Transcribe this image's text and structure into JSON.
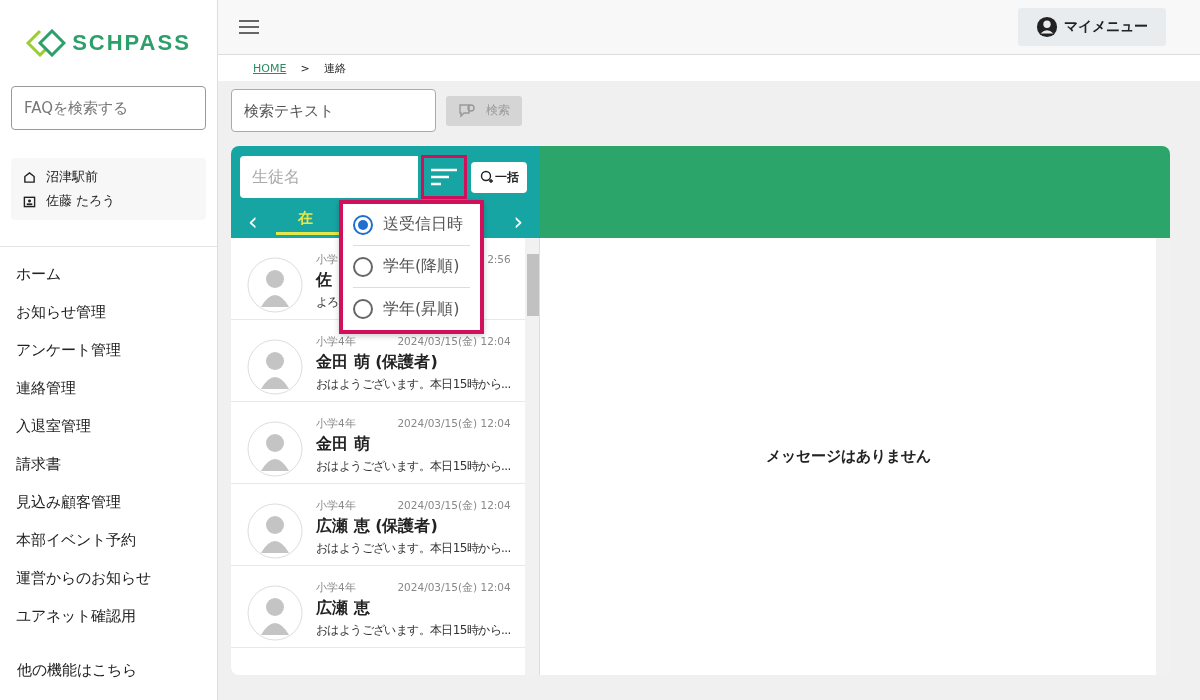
{
  "logo": {
    "text": "SCHPASS"
  },
  "faq_search": {
    "placeholder": "FAQを検索する"
  },
  "account": {
    "school": "沼津駅前",
    "user": "佐藤 たろう"
  },
  "nav": [
    {
      "label": "ホーム"
    },
    {
      "label": "お知らせ管理"
    },
    {
      "label": "アンケート管理"
    },
    {
      "label": "連絡管理"
    },
    {
      "label": "入退室管理"
    },
    {
      "label": "請求書"
    },
    {
      "label": "見込み顧客管理"
    },
    {
      "label": "本部イベント予約"
    },
    {
      "label": "運営からのお知らせ"
    },
    {
      "label": "ユアネット確認用"
    }
  ],
  "more_link": "他の機能はこちら",
  "header": {
    "menu_button": "マイメニュー"
  },
  "breadcrumb": [
    {
      "label": "HOME",
      "link": true
    },
    {
      "label": "連絡",
      "link": false
    }
  ],
  "breadcrumb_separator": ">",
  "search": {
    "placeholder": "検索テキスト",
    "button": "検索",
    "button_disabled": true
  },
  "list_panel": {
    "student_placeholder": "生徒名",
    "bulk_button": "一括",
    "prev": "‹",
    "next": "›",
    "tabs": [
      {
        "label": "在",
        "selected": true
      }
    ]
  },
  "sort_menu": [
    {
      "label": "送受信日時",
      "selected": true
    },
    {
      "label": "学年(降順)",
      "selected": false
    },
    {
      "label": "学年(昇順)",
      "selected": false
    }
  ],
  "threads": [
    {
      "grade": "小学",
      "date": "2:56",
      "name": "佐",
      "preview": "よろ"
    },
    {
      "grade": "小学4年",
      "date": "2024/03/15(金) 12:04",
      "name": "金田 萌 (保護者)",
      "preview": "おはようございます。本日15時から..."
    },
    {
      "grade": "小学4年",
      "date": "2024/03/15(金) 12:04",
      "name": "金田 萌",
      "preview": "おはようございます。本日15時から..."
    },
    {
      "grade": "小学4年",
      "date": "2024/03/15(金) 12:04",
      "name": "広瀬 恵 (保護者)",
      "preview": "おはようございます。本日15時から..."
    },
    {
      "grade": "小学4年",
      "date": "2024/03/15(金) 12:04",
      "name": "広瀬 恵",
      "preview": "おはようございます。本日15時から..."
    }
  ],
  "empty_message": "メッセージはありません"
}
